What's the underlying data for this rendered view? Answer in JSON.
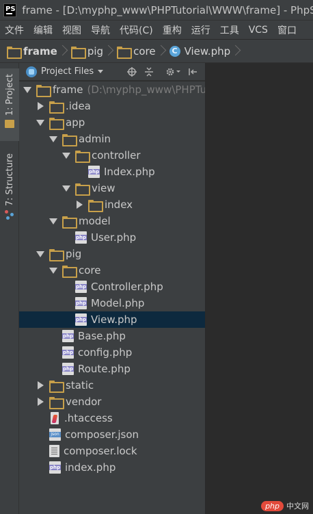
{
  "window": {
    "app_logo": "PS",
    "title": "frame - [D:\\myphp_www\\PHPTutorial\\WWW\\frame] - PhpSto"
  },
  "menu": [
    "文件",
    "编辑",
    "视图",
    "导航",
    "代码(C)",
    "重构",
    "运行",
    "工具",
    "VCS",
    "窗口"
  ],
  "breadcrumb": [
    {
      "label": "frame",
      "icon": "folder-icon"
    },
    {
      "label": "pig",
      "icon": "folder-icon"
    },
    {
      "label": "core",
      "icon": "folder-icon"
    },
    {
      "label": "View.php",
      "icon": "class-icon",
      "icon_text": "C"
    }
  ],
  "toolstrip": {
    "project_tab": "1: Project",
    "structure_tab": "7: Structure"
  },
  "panel": {
    "title": "Project Files",
    "buttons": [
      "locate-icon",
      "collapse-all-icon",
      "gear-icon",
      "hide-icon"
    ]
  },
  "tree": [
    {
      "level": 0,
      "type": "folder",
      "state": "open",
      "label": "frame",
      "path": "(D:\\myphp_www\\PHPTut"
    },
    {
      "level": 1,
      "type": "folder",
      "state": "closed",
      "label": ".idea"
    },
    {
      "level": 1,
      "type": "folder",
      "state": "open",
      "label": "app"
    },
    {
      "level": 2,
      "type": "folder",
      "state": "open",
      "label": "admin"
    },
    {
      "level": 3,
      "type": "folder",
      "state": "open",
      "label": "controller"
    },
    {
      "level": 4,
      "type": "php",
      "label": "Index.php"
    },
    {
      "level": 3,
      "type": "folder",
      "state": "open",
      "label": "view"
    },
    {
      "level": 4,
      "type": "folder",
      "state": "closed",
      "label": "index"
    },
    {
      "level": 2,
      "type": "folder",
      "state": "open",
      "label": "model"
    },
    {
      "level": 3,
      "type": "php",
      "label": "User.php"
    },
    {
      "level": 1,
      "type": "folder",
      "state": "open",
      "label": "pig"
    },
    {
      "level": 2,
      "type": "folder",
      "state": "open",
      "label": "core"
    },
    {
      "level": 3,
      "type": "php",
      "label": "Controller.php"
    },
    {
      "level": 3,
      "type": "php",
      "label": "Model.php"
    },
    {
      "level": 3,
      "type": "php",
      "label": "View.php",
      "selected": true
    },
    {
      "level": 2,
      "type": "php",
      "label": "Base.php"
    },
    {
      "level": 2,
      "type": "php",
      "label": "config.php"
    },
    {
      "level": 2,
      "type": "php",
      "label": "Route.php"
    },
    {
      "level": 1,
      "type": "folder",
      "state": "closed",
      "label": "static"
    },
    {
      "level": 1,
      "type": "folder",
      "state": "closed",
      "label": "vendor"
    },
    {
      "level": 1,
      "type": "htaccess",
      "label": ".htaccess"
    },
    {
      "level": 1,
      "type": "json",
      "label": "composer.json"
    },
    {
      "level": 1,
      "type": "text",
      "label": "composer.lock"
    },
    {
      "level": 1,
      "type": "php",
      "label": "index.php"
    }
  ],
  "watermark": {
    "logo": "php",
    "text": "中文网"
  },
  "colors": {
    "background": "#2b2b2b",
    "panel": "#3c3f41",
    "selection": "#0d293e",
    "folder": "#c8a04a",
    "php_badge": "#8a86c8"
  }
}
